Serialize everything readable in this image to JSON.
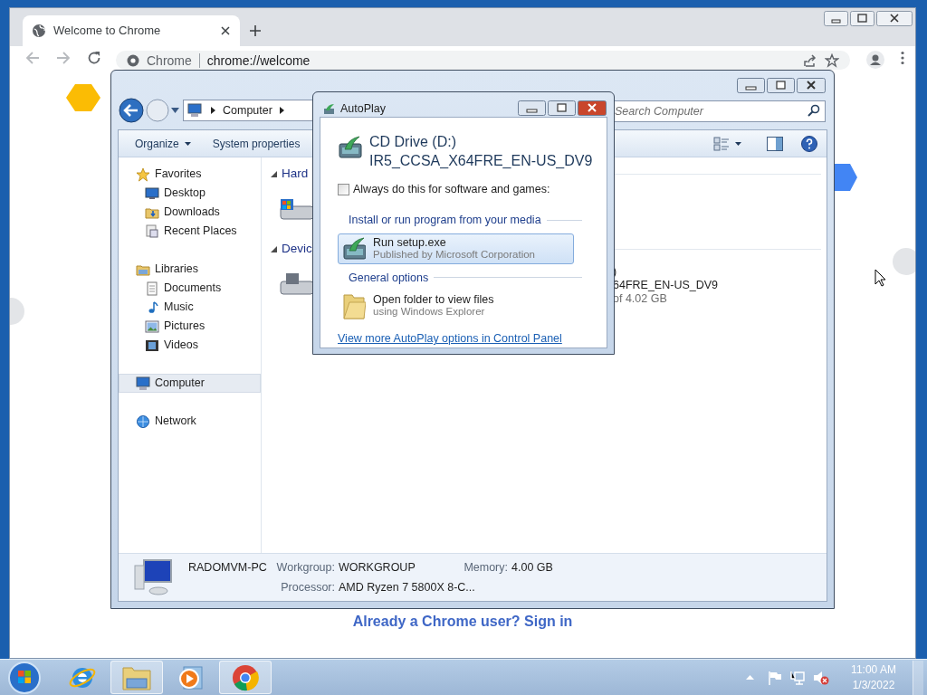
{
  "browser": {
    "tab": {
      "title": "Welcome to Chrome",
      "selected": true
    },
    "omnibox": {
      "site": "Chrome",
      "url": "chrome://welcome"
    },
    "sign_in_link": "Already a Chrome user? Sign in"
  },
  "explorer": {
    "breadcrumb": "Computer",
    "search": {
      "placeholder": "Search Computer"
    },
    "commands": [
      {
        "label": "Organize",
        "dropdown": true
      },
      {
        "label": "System properties",
        "dropdown": false
      }
    ],
    "navigation": [
      {
        "label": "Favorites",
        "kind": "favorites",
        "selected": false,
        "children": [
          {
            "label": "Desktop",
            "kind": "desktop",
            "selected": false
          },
          {
            "label": "Downloads",
            "kind": "downloads",
            "selected": false
          },
          {
            "label": "Recent Places",
            "kind": "recent",
            "selected": false
          }
        ]
      },
      {
        "label": "Libraries",
        "kind": "libraries",
        "selected": false,
        "children": [
          {
            "label": "Documents",
            "kind": "documents",
            "selected": false
          },
          {
            "label": "Music",
            "kind": "music",
            "selected": false
          },
          {
            "label": "Pictures",
            "kind": "pictures",
            "selected": false
          },
          {
            "label": "Videos",
            "kind": "videos",
            "selected": false
          }
        ]
      },
      {
        "label": "Computer",
        "kind": "computer",
        "selected": true
      },
      {
        "label": "Network",
        "kind": "network",
        "selected": false
      }
    ],
    "groups": [
      {
        "heading": "Hard",
        "kind": "disk"
      },
      {
        "heading": "Devic",
        "kind": "removable"
      }
    ],
    "drive_details": [
      {
        "text": ")",
        "kind": "name"
      },
      {
        "text": "64FRE_EN-US_DV9",
        "kind": "name"
      },
      {
        "text": "of 4.02 GB",
        "kind": "size"
      }
    ],
    "details": {
      "computer_name": "RADOMVM-PC",
      "fields": [
        {
          "label": "Workgroup:",
          "value": "WORKGROUP"
        },
        {
          "label": "Memory:",
          "value": "4.00 GB"
        },
        {
          "label": "Processor:",
          "value": "AMD Ryzen 7 5800X 8-C..."
        }
      ]
    }
  },
  "autoplay": {
    "title": "AutoPlay",
    "drive_name": "CD Drive (D:)",
    "volume": "IR5_CCSA_X64FRE_EN-US_DV9",
    "always": {
      "label": "Always do this for software and games:",
      "checked": false
    },
    "sections": [
      {
        "heading": "Install or run program from your media",
        "options": [
          {
            "title": "Run setup.exe",
            "subtitle": "Published by Microsoft Corporation",
            "kind": "setup",
            "selected": true
          }
        ]
      },
      {
        "heading": "General options",
        "options": [
          {
            "title": "Open folder to view files",
            "subtitle": "using Windows Explorer",
            "kind": "folder",
            "selected": false
          }
        ]
      }
    ],
    "link": "View more AutoPlay options in Control Panel"
  },
  "taskbar": {
    "apps": [
      {
        "kind": "ie",
        "running": false
      },
      {
        "kind": "explorer",
        "running": true
      },
      {
        "kind": "media",
        "running": false
      },
      {
        "kind": "chrome",
        "running": true
      }
    ],
    "clock": {
      "time": "11:00 AM",
      "date": "1/3/2022"
    }
  }
}
